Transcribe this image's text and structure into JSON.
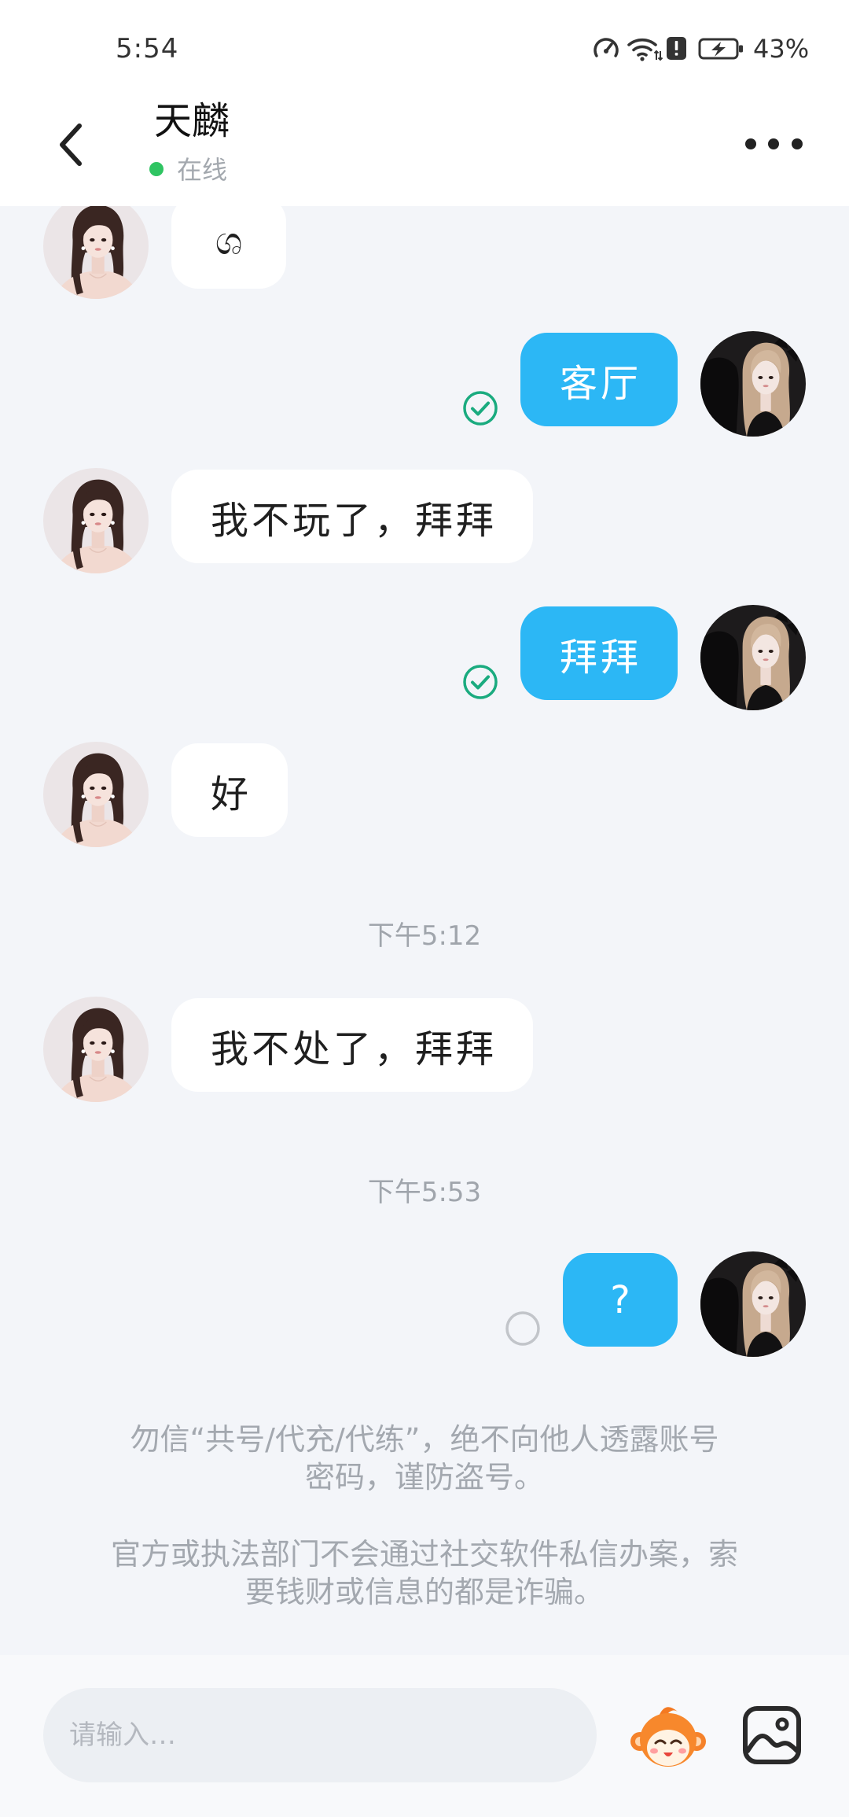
{
  "status_bar": {
    "time": "5:54",
    "battery": "43%",
    "icons": [
      "speed-gauge-icon",
      "wifi-icon",
      "alert-icon",
      "battery-charging-icon"
    ]
  },
  "header": {
    "contact_name": "天麟",
    "presence": "在线",
    "presence_color": "#2fc462",
    "back_icon": "chevron-left-icon",
    "more_icon": "more-horizontal-icon"
  },
  "messages": [
    {
      "outgoing": false,
      "text": "ශ"
    },
    {
      "outgoing": true,
      "text": "客厅",
      "status_icon": "check-circle-icon"
    },
    {
      "outgoing": false,
      "text": "我不玩了，拜拜"
    },
    {
      "outgoing": true,
      "text": "拜拜",
      "status_icon": "check-circle-icon"
    },
    {
      "outgoing": false,
      "text": "好"
    },
    {
      "timestamp": "下午5:12"
    },
    {
      "outgoing": false,
      "text": "我不处了，拜拜"
    },
    {
      "timestamp": "下午5:53"
    },
    {
      "outgoing": true,
      "text": "?",
      "status_icon": "pending-circle-icon"
    }
  ],
  "notice": {
    "paragraphs": [
      [
        "勿信“共号/代充/代练”，绝不向他人透露账号",
        "密码，谨防盗号。"
      ],
      [
        "官方或执法部门不会通过社交软件私信办案，索",
        "要钱财或信息的都是诈骗。"
      ]
    ]
  },
  "composer": {
    "placeholder": "请输入…",
    "sticker_icon": "mascot-sticker-icon",
    "image_icon": "image-picker-icon"
  },
  "colors": {
    "chat_background": "#f3f5f9",
    "incoming_bubble": "#ffffff",
    "outgoing_bubble": "#2cb7f5",
    "read_check": "#1aab7f",
    "pending": "#c2c5ca"
  }
}
